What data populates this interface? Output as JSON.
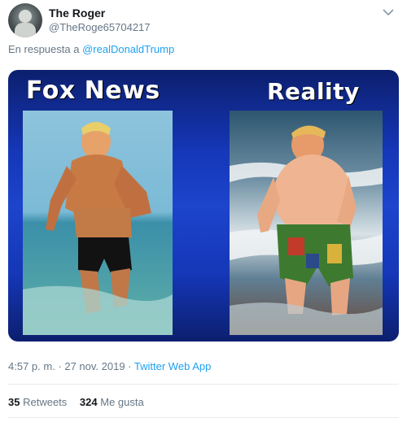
{
  "tweet": {
    "display_name": "The Roger",
    "handle": "@TheRoge65704217",
    "reply_prefix": "En respuesta a",
    "reply_mention": "@realDonaldTrump",
    "time": "4:57 p. m. · 27 nov. 2019 ·",
    "source_app": "Twitter Web App",
    "retweets_count": "35",
    "retweets_label": "Retweets",
    "likes_count": "324",
    "likes_label": "Me gusta"
  },
  "image": {
    "left_title": "Fox News",
    "right_title": "Reality"
  },
  "icons": {
    "more": "chevron-down-icon",
    "avatar": "avatar"
  },
  "colors": {
    "link": "#1da1f2",
    "muted": "#657786",
    "text": "#14171a",
    "media_blue": "#1d44cc"
  }
}
